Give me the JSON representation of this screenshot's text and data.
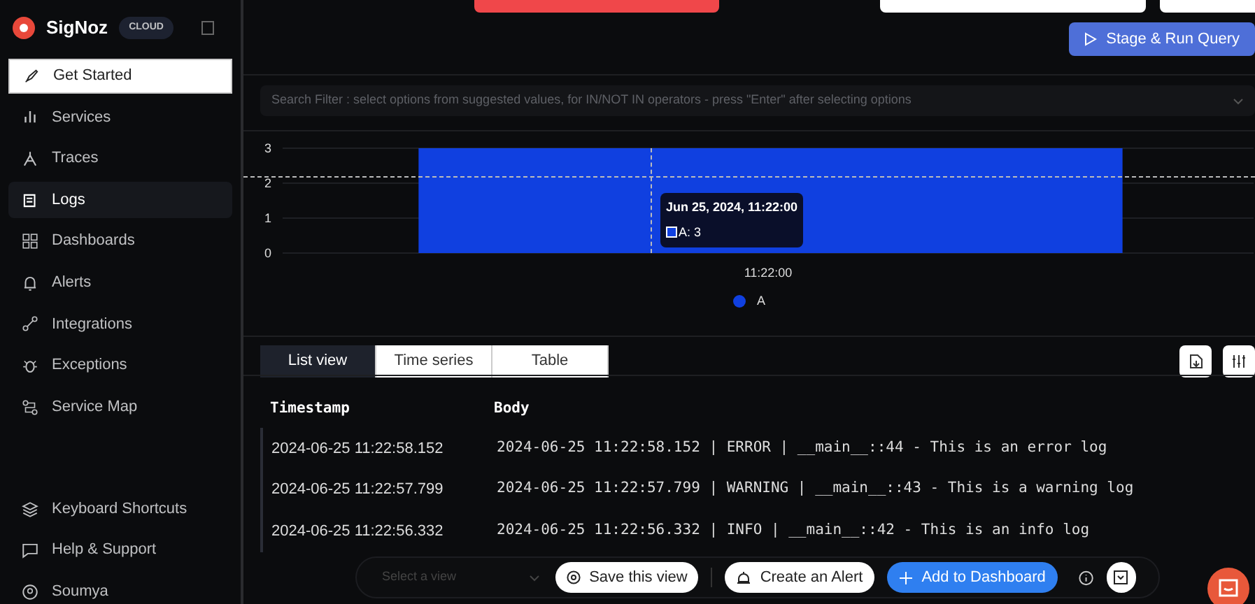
{
  "sidebar": {
    "brand": "SigNoz",
    "badge": "CLOUD",
    "items": [
      {
        "label": "Get Started",
        "selected": false,
        "focused": true
      },
      {
        "label": "Services",
        "selected": false,
        "focused": false
      },
      {
        "label": "Traces",
        "selected": false,
        "focused": false
      },
      {
        "label": "Logs",
        "selected": true,
        "focused": false
      },
      {
        "label": "Dashboards",
        "selected": false,
        "focused": false
      },
      {
        "label": "Alerts",
        "selected": false,
        "focused": false
      },
      {
        "label": "Integrations",
        "selected": false,
        "focused": false
      },
      {
        "label": "Exceptions",
        "selected": false,
        "focused": false
      },
      {
        "label": "Service Map",
        "selected": false,
        "focused": false
      }
    ],
    "footer": [
      {
        "label": "Keyboard Shortcuts"
      },
      {
        "label": "Help & Support"
      },
      {
        "label": "Soumya"
      }
    ]
  },
  "run_button": "Stage & Run Query",
  "search_filter": {
    "placeholder": "Search Filter : select options from suggested values, for IN/NOT IN operators - press \"Enter\" after selecting options"
  },
  "chart": {
    "chart_data": {
      "type": "bar",
      "categories": [
        "11:22:00"
      ],
      "series": [
        {
          "name": "A",
          "color": "#1040e0",
          "values": [
            3
          ]
        }
      ],
      "ylim": [
        0,
        3
      ],
      "yticks": [
        0,
        1,
        2,
        3
      ]
    },
    "tooltip": {
      "title": "Jun 25, 2024, 11:22:00",
      "entry": "A: 3"
    }
  },
  "view_tabs": [
    {
      "label": "List view",
      "selected": true
    },
    {
      "label": "Time series",
      "selected": false
    },
    {
      "label": "Table",
      "selected": false
    }
  ],
  "table": {
    "columns": [
      "Timestamp",
      "Body"
    ],
    "rows": [
      [
        "2024-06-25 11:22:58.152",
        "2024-06-25 11:22:58.152 | ERROR | __main__::44 - This is an error log"
      ],
      [
        "2024-06-25 11:22:57.799",
        "2024-06-25 11:22:57.799 | WARNING | __main__::43 - This is a warning log"
      ],
      [
        "2024-06-25 11:22:56.332",
        "2024-06-25 11:22:56.332 | INFO | __main__::42 - This is an info log"
      ]
    ]
  },
  "bottom_bar": {
    "view_select": {
      "placeholder": "Select a view"
    },
    "save_button": "Save this view",
    "alert_button": "Create an Alert",
    "dashboard_button": "Add to Dashboard"
  }
}
